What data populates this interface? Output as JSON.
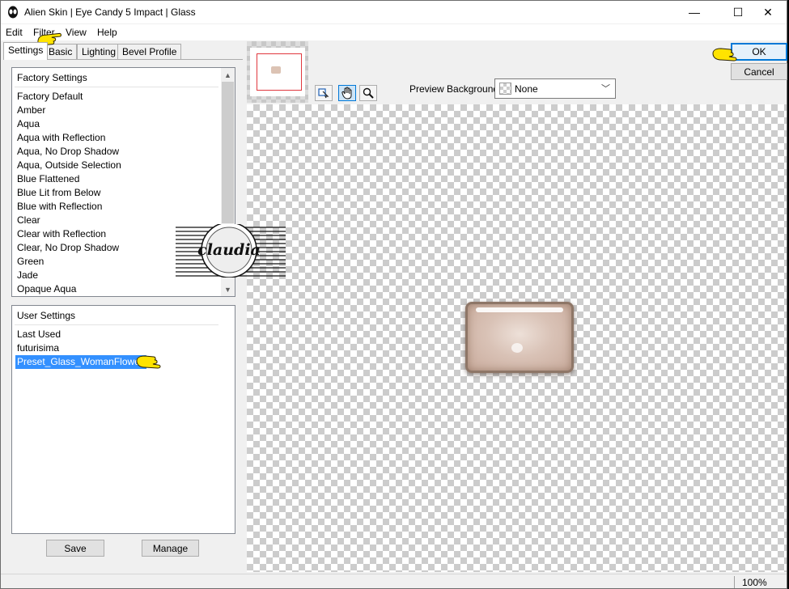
{
  "window": {
    "title": "Alien Skin | Eye Candy 5 Impact | Glass",
    "icon": "alien-skin-icon"
  },
  "title_buttons": {
    "minimize": "—",
    "maximize": "☐",
    "close": "✕"
  },
  "menu": [
    "Edit",
    "Filter",
    "View",
    "Help"
  ],
  "tabs": [
    "Settings",
    "Basic",
    "Lighting",
    "Bevel Profile"
  ],
  "factory_settings": {
    "header": "Factory Settings",
    "items": [
      "Factory Default",
      "Amber",
      "Aqua",
      "Aqua with Reflection",
      "Aqua, No Drop Shadow",
      "Aqua, Outside Selection",
      "Blue Flattened",
      "Blue Lit from Below",
      "Blue with Reflection",
      "Clear",
      "Clear with Reflection",
      "Clear, No Drop Shadow",
      "Green",
      "Jade",
      "Opaque Aqua"
    ]
  },
  "user_settings": {
    "header": "User Settings",
    "items": [
      "Last Used",
      "futurisima",
      "Preset_Glass_WomanFlower"
    ],
    "selected": "Preset_Glass_WomanFlower"
  },
  "buttons": {
    "save": "Save",
    "manage": "Manage",
    "ok": "OK",
    "cancel": "Cancel"
  },
  "preview": {
    "background_label": "Preview Background:",
    "background_value": "None",
    "tools": [
      "navigate-icon",
      "hand-icon",
      "zoom-icon"
    ]
  },
  "status": {
    "zoom": "100%"
  },
  "watermark": {
    "text": "claudia"
  },
  "colors": {
    "selection": "#3390ff",
    "accent": "#0078d7",
    "hand_pointer": "#ffe300"
  }
}
